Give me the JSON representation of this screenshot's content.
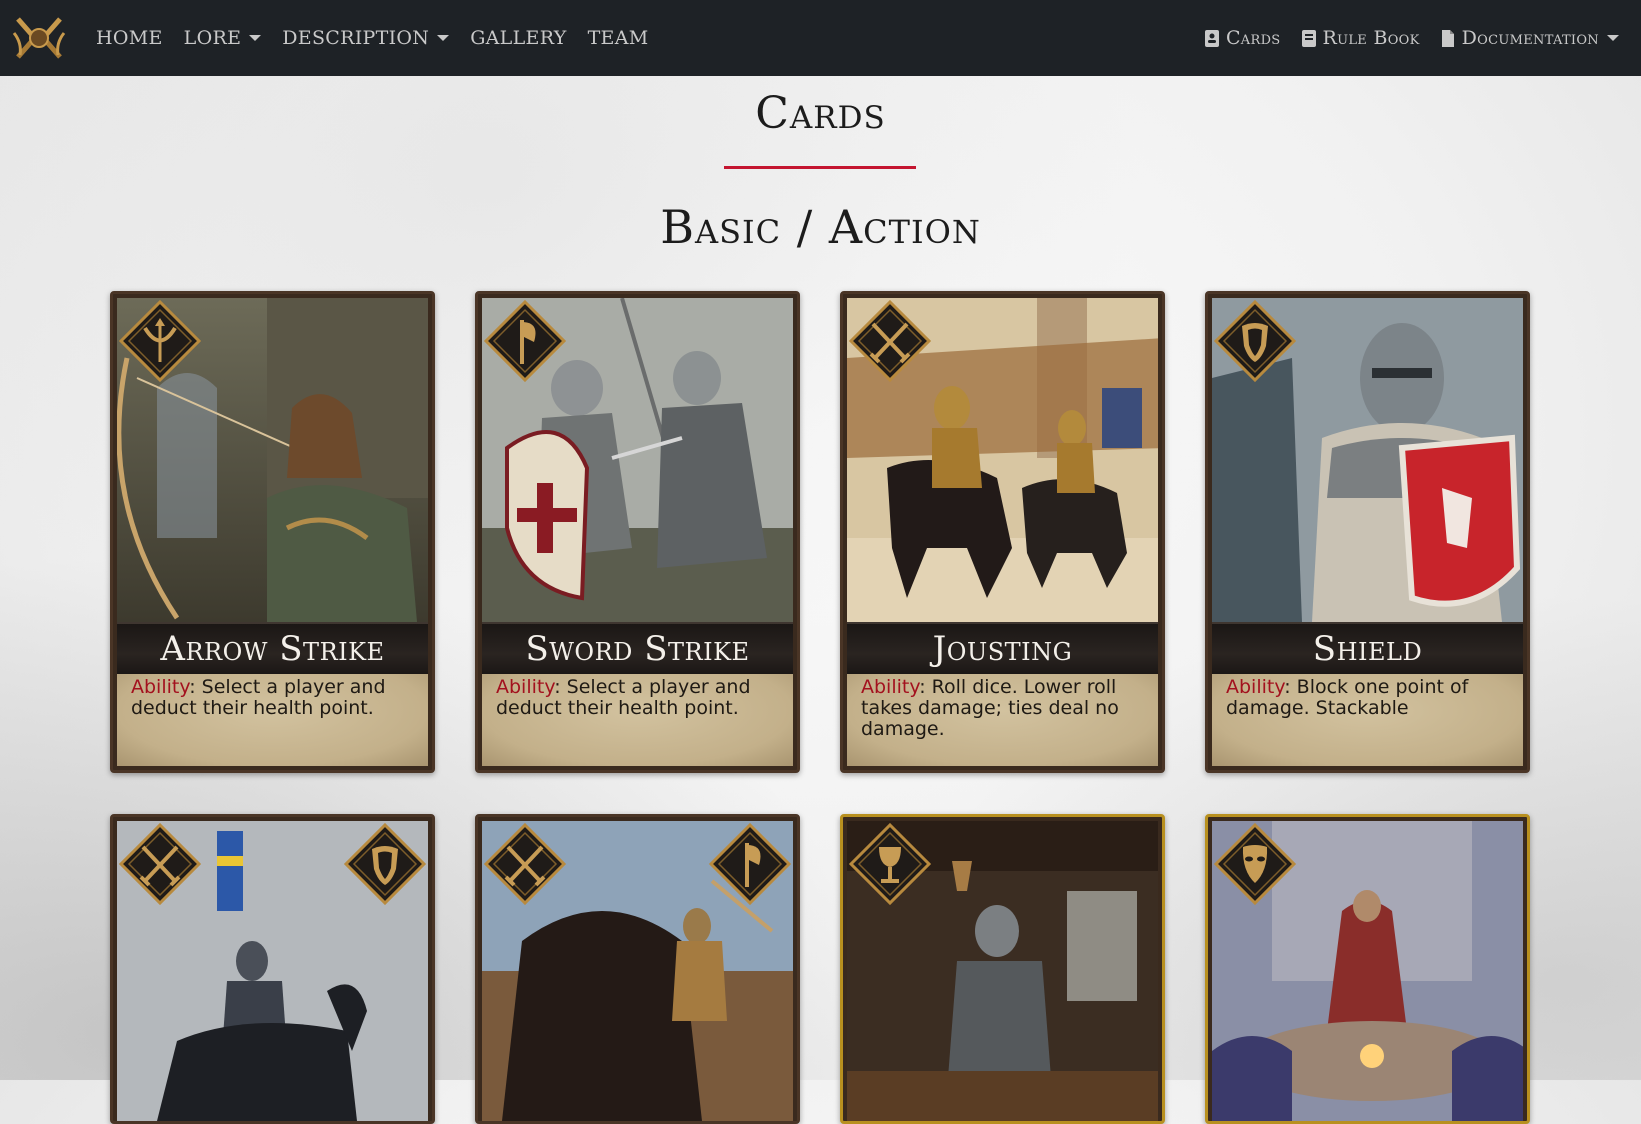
{
  "nav": {
    "left": [
      {
        "label": "HOME",
        "dropdown": false
      },
      {
        "label": "LORE",
        "dropdown": true
      },
      {
        "label": "DESCRIPTION",
        "dropdown": true
      },
      {
        "label": "GALLERY",
        "dropdown": false
      },
      {
        "label": "TEAM",
        "dropdown": false
      }
    ],
    "right": [
      {
        "label": "Cards",
        "icon": "id-card-icon"
      },
      {
        "label": "Rule Book",
        "icon": "book-icon"
      },
      {
        "label": "Documentation",
        "icon": "file-icon",
        "dropdown": true
      }
    ]
  },
  "page": {
    "title": "Cards",
    "section": "Basic / Action"
  },
  "cards_row1": [
    {
      "name": "Arrow Strike",
      "ability_label": "Ability",
      "ability_text": ": Select a player and deduct their health point.",
      "badge": "bow-icon"
    },
    {
      "name": "Sword Strike",
      "ability_label": "Ability",
      "ability_text": ": Select a player and deduct their health point.",
      "badge": "axe-icon"
    },
    {
      "name": "Jousting",
      "ability_label": "Ability",
      "ability_text": ": Roll dice. Lower roll takes damage; ties deal no damage.",
      "badge": "crossed-swords-icon"
    },
    {
      "name": "Shield",
      "ability_label": "Ability",
      "ability_text": ": Block one point of damage. Stackable",
      "badge": "shield-icon"
    }
  ],
  "cards_row2": [
    {
      "badges": [
        "crossed-swords-icon",
        "shield-icon"
      ]
    },
    {
      "badges": [
        "crossed-swords-icon",
        "axe-icon"
      ]
    },
    {
      "badges": [
        "goblet-icon"
      ],
      "border": "gold"
    },
    {
      "badges": [
        "mask-icon"
      ],
      "border": "gold"
    }
  ],
  "colors": {
    "navbar": "#1e2226",
    "accent": "#c41530",
    "ability_label": "#a3111e"
  }
}
